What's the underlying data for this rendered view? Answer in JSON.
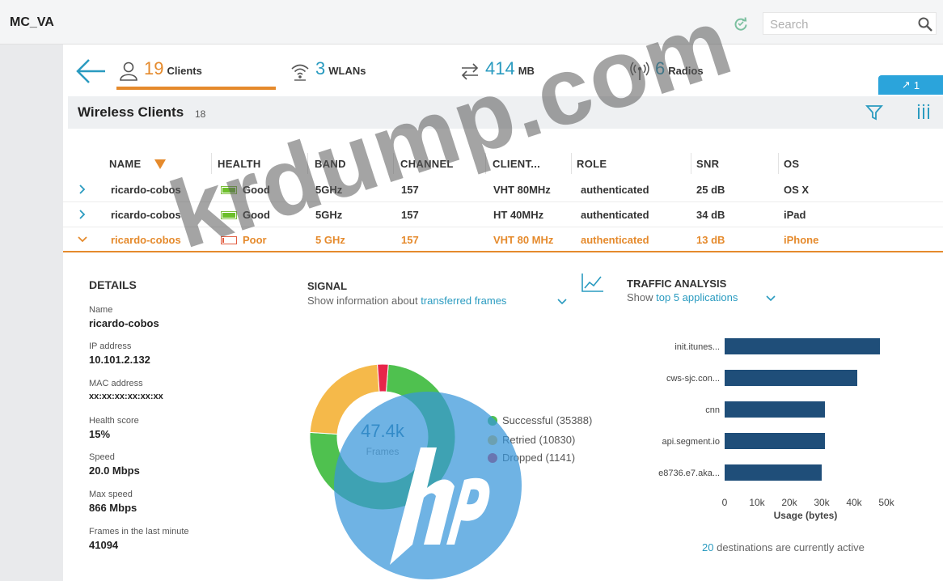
{
  "app": {
    "title": "MC_VA"
  },
  "search": {
    "placeholder": "Search"
  },
  "summary": {
    "clients": {
      "count": "19",
      "label": "Clients"
    },
    "wlans": {
      "count": "3",
      "label": "WLANs"
    },
    "usage": {
      "count": "414",
      "label": "MB"
    },
    "radios": {
      "count": "6",
      "label": "Radios"
    }
  },
  "pin_badge": {
    "label": "1"
  },
  "section": {
    "title": "Wireless Clients",
    "count": "18"
  },
  "table": {
    "columns": [
      "NAME",
      "HEALTH",
      "BAND",
      "CHANNEL",
      "CLIENT...",
      "ROLE",
      "SNR",
      "OS"
    ],
    "rows": [
      {
        "name": "ricardo-cobos",
        "health": "Good",
        "health_level": 1.0,
        "band": "5GHz",
        "channel": "157",
        "client": "VHT 80MHz",
        "role": "authenticated",
        "snr": "25 dB",
        "os": "OS X"
      },
      {
        "name": "ricardo-cobos",
        "health": "Good",
        "health_level": 1.0,
        "band": "5GHz",
        "channel": "157",
        "client": "HT 40MHz",
        "role": "authenticated",
        "snr": "34 dB",
        "os": "iPad"
      },
      {
        "name": "ricardo-cobos",
        "health": "Poor",
        "health_level": 0.15,
        "band": "5 GHz",
        "channel": "157",
        "client": "VHT 80 MHz",
        "role": "authenticated",
        "snr": "13 dB",
        "os": "iPhone"
      }
    ]
  },
  "details": {
    "title": "DETAILS",
    "fields": [
      {
        "label": "Name",
        "value": "ricardo-cobos"
      },
      {
        "label": "IP address",
        "value": "10.101.2.132"
      },
      {
        "label": "MAC address",
        "value": "xx:xx:xx:xx:xx:xx"
      },
      {
        "label": "Health score",
        "value": "15%"
      },
      {
        "label": "Speed",
        "value": "20.0 Mbps"
      },
      {
        "label": "Max speed",
        "value": "866 Mbps"
      },
      {
        "label": "Frames in the last minute",
        "value": "41094"
      }
    ]
  },
  "signal": {
    "title": "SIGNAL",
    "subtitle_prefix": "Show information about",
    "subtitle_link": "transferred frames",
    "center_value": "47.4k",
    "center_label": "Frames"
  },
  "traffic": {
    "title": "TRAFFIC ANALYSIS",
    "subtitle_prefix": "Show",
    "subtitle_link": "top 5 applications",
    "footnote_count": "20",
    "footnote_text": "destinations are currently active"
  },
  "colors": {
    "accent": "#e58a2c",
    "teal": "#2a9bc0",
    "bar": "#1f4e79",
    "good": "#6cbf2a",
    "poor": "#e25c3f"
  },
  "chart_data": [
    {
      "type": "pie",
      "variant": "donut",
      "categories": [
        "Successful (35388)",
        "Retried (10830)",
        "Dropped (1141)"
      ],
      "values": [
        35388,
        10830,
        1141
      ],
      "colors": [
        "#4fc14f",
        "#f5b94a",
        "#e8254a"
      ],
      "legend": "right"
    },
    {
      "type": "bar",
      "orientation": "horizontal",
      "categories": [
        "init.itunes...",
        "cws-sjc.con...",
        "cnn",
        "api.segment.io",
        "e8736.e7.aka..."
      ],
      "values": [
        48000,
        41000,
        31000,
        31000,
        30000
      ],
      "xlabel": "Usage (bytes)",
      "xlim": [
        0,
        50000
      ],
      "xticks": [
        "0",
        "10k",
        "20k",
        "30k",
        "40k",
        "50k"
      ],
      "color": "#1f4e79"
    }
  ],
  "watermark": {
    "text": "krdump.com"
  }
}
